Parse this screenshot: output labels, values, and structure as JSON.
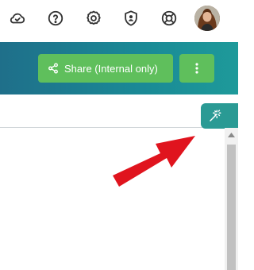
{
  "header": {
    "icons": [
      "cloud-check-icon",
      "help-icon",
      "settings-icon",
      "shield-user-icon",
      "lifebuoy-icon"
    ],
    "avatar_alt": "user avatar"
  },
  "toolbar": {
    "share_label": "Share (Internal only)",
    "more_icon": "more-vertical-icon"
  },
  "side_tab": {
    "icon": "magic-wand-icon"
  },
  "colors": {
    "teal_bar": "#1a8a96",
    "button_green": "#5fbf5c",
    "tab_teal": "#2a9a94",
    "arrow_red": "#e0141e"
  }
}
